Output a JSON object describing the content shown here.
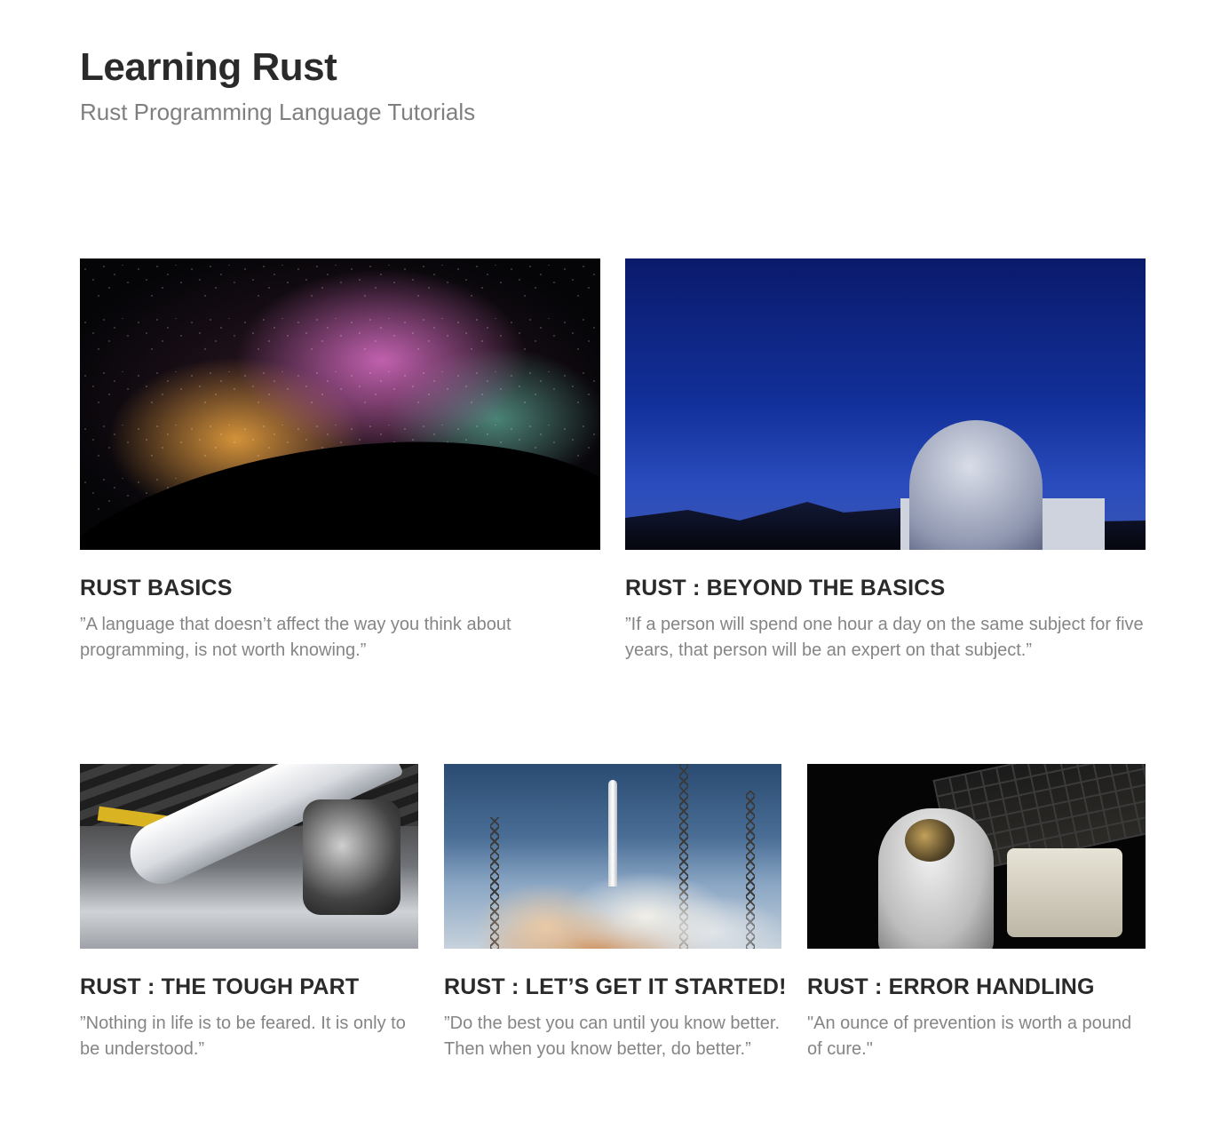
{
  "header": {
    "title": "Learning Rust",
    "subtitle": "Rust Programming Language Tutorials"
  },
  "cards": [
    {
      "title": "RUST BASICS",
      "quote": "”A language that doesn’t affect the way you think about programming, is not worth knowing.”",
      "image": "galaxy-silhouette-photo"
    },
    {
      "title": "RUST : BEYOND THE BASICS",
      "quote": "”If a person will spend one hour a day on the same subject for five years, that person will be an expert on that subject.”",
      "image": "observatory-night-photo"
    },
    {
      "title": "RUST : THE TOUGH PART",
      "quote": "”Nothing in life is to be feared. It is only to be understood.”",
      "image": "rocket-hangar-photo"
    },
    {
      "title": "RUST : LET’S GET IT STARTED!",
      "quote": "”Do the best you can until you know better. Then when you know better, do better.”",
      "image": "rocket-launch-photo"
    },
    {
      "title": "RUST : ERROR HANDLING",
      "quote": "\"An ounce of prevention is worth a pound of cure.\"",
      "image": "astronaut-spacewalk-photo"
    }
  ],
  "colors": {
    "title_text": "#2a2a2a",
    "subtitle_text": "#7f7f7f",
    "quote_text": "#858585",
    "background": "#ffffff"
  }
}
